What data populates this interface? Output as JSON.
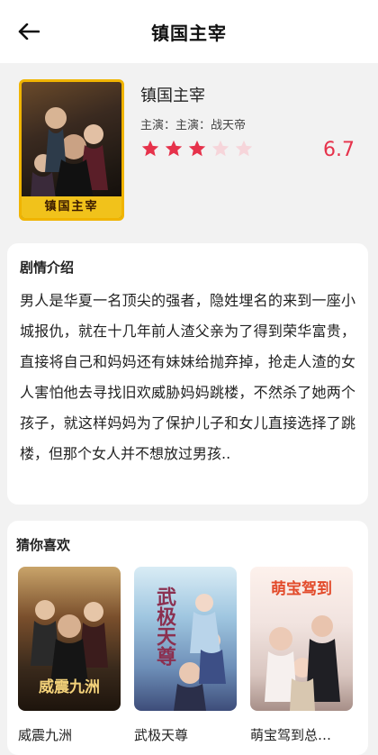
{
  "header": {
    "title": "镇国主宰",
    "back_icon": "arrow-left-icon"
  },
  "drama": {
    "poster_caption": "镇国主宰",
    "title": "镇国主宰",
    "cast": "主演：主演：战天帝",
    "rating": {
      "filled_stars": 3,
      "total_stars": 5,
      "score": "6.7"
    },
    "colors": {
      "accent": "#e6324b",
      "star_off": "#f6d5da",
      "poster_border": "#f0b400"
    }
  },
  "synopsis": {
    "title": "剧情介绍",
    "text": "男人是华夏一名顶尖的强者，隐姓埋名的来到一座小城报仇，就在十几年前人渣父亲为了得到荣华富贵，直接将自己和妈妈还有妹妹给抛弃掉，抢走人渣的女人害怕他去寻找旧欢威胁妈妈跳楼，不然杀了她两个孩子，就这样妈妈为了保护儿子和女儿直接选择了跳楼，但那个女人并不想放过男孩.."
  },
  "recommend": {
    "title": "猜你喜欢",
    "items": [
      {
        "name": "威震九洲",
        "cover_caption": "威震九洲"
      },
      {
        "name": "武极天尊",
        "cover_caption": "武极天尊"
      },
      {
        "name": "萌宝驾到总…",
        "cover_caption": "萌宝驾到"
      }
    ]
  }
}
